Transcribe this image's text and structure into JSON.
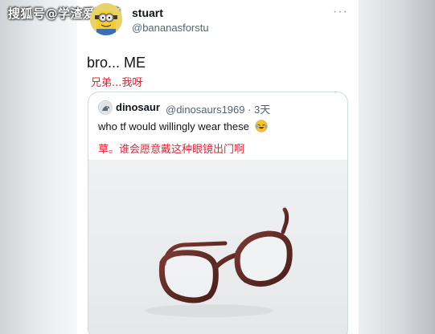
{
  "watermark": {
    "text": "搜狐号@学渣爱吐槽"
  },
  "tweet": {
    "author_name": "stuart",
    "author_handle": "@bananasforstu",
    "text": "bro... ME",
    "translation": "兄弟...我呀",
    "more_icon": "more-horizontal-icon"
  },
  "quoted_tweet": {
    "author_name": "dinosaur",
    "author_handle_time": "@dinosaurs1969 · 3天",
    "text": "who tf would willingly wear these",
    "emoji": "laughing-crying-emoji",
    "translation": "草。谁会愿意戴这种眼镜出门啊",
    "media": "glasses-photo"
  },
  "colors": {
    "translation_red": "#e0243a",
    "handle_gray": "#536471",
    "border": "#cfd9de",
    "glasses_frame": "#6b2f2a"
  }
}
